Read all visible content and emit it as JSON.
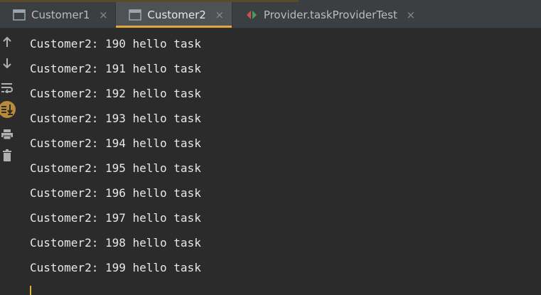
{
  "tabs": [
    {
      "label": "Customer1",
      "active": false,
      "icon": "run-window-icon"
    },
    {
      "label": "Customer2",
      "active": true,
      "icon": "run-window-icon"
    },
    {
      "label": "Provider.taskProviderTest",
      "active": false,
      "icon": "test-run-icon"
    }
  ],
  "tab_close_glyph": "×",
  "toolbar": [
    {
      "name": "scroll-up-icon"
    },
    {
      "name": "scroll-down-icon"
    },
    {
      "name": "soft-wrap-icon"
    },
    {
      "name": "scroll-to-end-icon"
    },
    {
      "name": "print-icon"
    },
    {
      "name": "clear-all-icon"
    }
  ],
  "console_lines": [
    "Customer2: 190 hello task",
    "Customer2: 191 hello task",
    "Customer2: 192 hello task",
    "Customer2: 193 hello task",
    "Customer2: 194 hello task",
    "Customer2: 195 hello task",
    "Customer2: 196 hello task",
    "Customer2: 197 hello task",
    "Customer2: 198 hello task",
    "Customer2: 199 hello task"
  ],
  "colors": {
    "background": "#2b2b2b",
    "tabbar": "#3c3f41",
    "active_tab": "#4e5254",
    "accent": "#e0a83a",
    "text": "#e8e8e8"
  }
}
